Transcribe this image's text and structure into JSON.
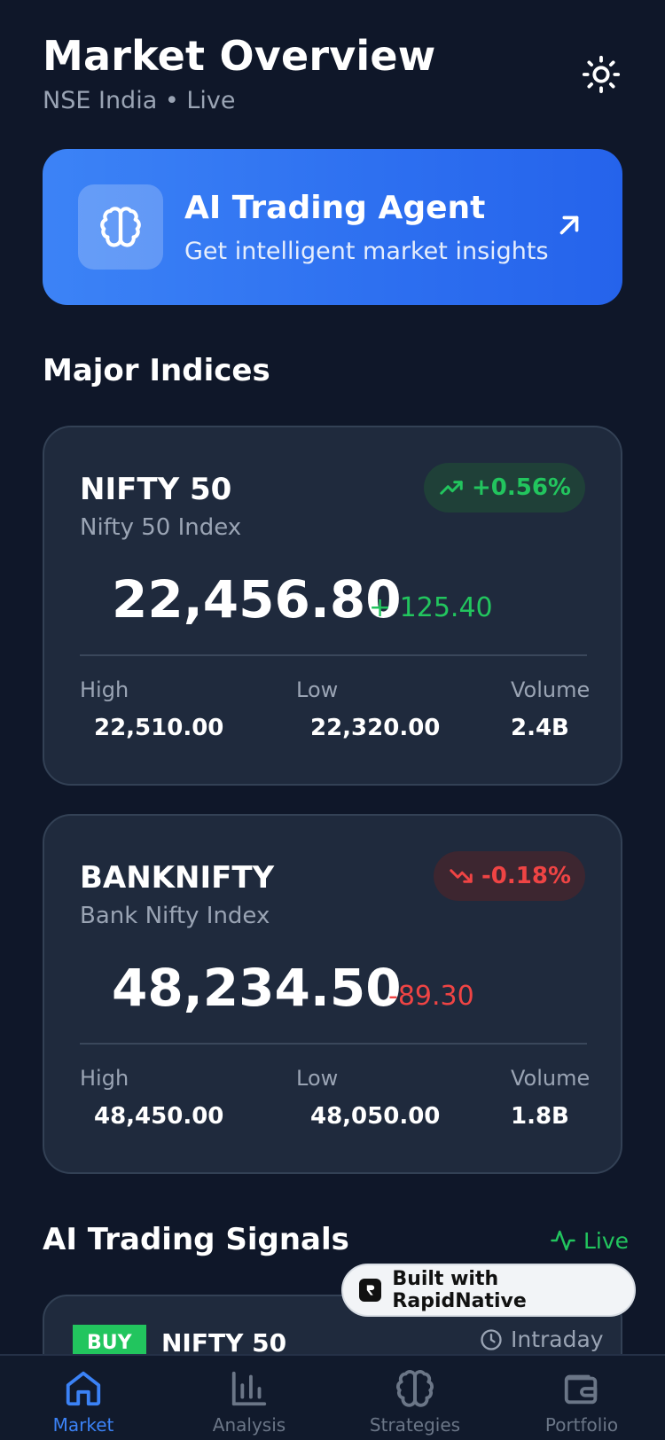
{
  "header": {
    "title": "Market Overview",
    "subtitle": "NSE India • Live"
  },
  "ai_banner": {
    "title": "AI Trading Agent",
    "subtitle": "Get intelligent market insights"
  },
  "sections": {
    "indices": "Major Indices",
    "signals": "AI Trading Signals",
    "live": "Live"
  },
  "indices": [
    {
      "name": "NIFTY 50",
      "full_name": "Nifty 50 Index",
      "badge": "+0.56%",
      "direction": "up",
      "price": "22,456.80",
      "change": "+  125.40",
      "stats": {
        "high_label": "High",
        "high": "22,510.00",
        "low_label": "Low",
        "low": "22,320.00",
        "volume_label": "Volume",
        "volume": "2.4B"
      }
    },
    {
      "name": "BANKNIFTY",
      "full_name": "Bank Nifty Index",
      "badge": "-0.18%",
      "direction": "down",
      "price": "48,234.50",
      "change": "-89.30",
      "stats": {
        "high_label": "High",
        "high": "48,450.00",
        "low_label": "Low",
        "low": "48,050.00",
        "volume_label": "Volume",
        "volume": "1.8B"
      }
    }
  ],
  "signal": {
    "tag": "BUY",
    "name": "NIFTY 50",
    "timeframe": "Intraday"
  },
  "built_with": "Built with RapidNative",
  "nav": [
    {
      "label": "Market",
      "icon": "home-icon",
      "active": true
    },
    {
      "label": "Analysis",
      "icon": "bar-chart-icon",
      "active": false
    },
    {
      "label": "Strategies",
      "icon": "brain-icon",
      "active": false
    },
    {
      "label": "Portfolio",
      "icon": "wallet-icon",
      "active": false
    }
  ],
  "colors": {
    "background": "#0f1729",
    "card": "#1f2a3d",
    "accent": "#3b82f6",
    "positive": "#22c55e",
    "negative": "#ef4444",
    "muted": "#9aa4b4"
  }
}
